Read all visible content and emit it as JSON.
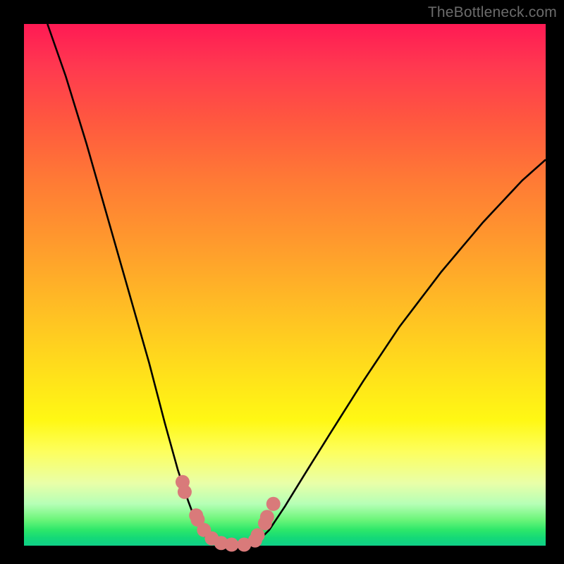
{
  "watermark": "TheBottleneck.com",
  "chart_data": {
    "type": "line",
    "title": "",
    "xlabel": "",
    "ylabel": "",
    "xlim": [
      0,
      1
    ],
    "ylim": [
      0,
      1
    ],
    "series": [
      {
        "name": "curve-left",
        "x": [
          0.045,
          0.08,
          0.12,
          0.16,
          0.2,
          0.24,
          0.27,
          0.295,
          0.315,
          0.33,
          0.345,
          0.36
        ],
        "y": [
          1.0,
          0.9,
          0.77,
          0.63,
          0.49,
          0.35,
          0.235,
          0.145,
          0.085,
          0.045,
          0.02,
          0.005
        ]
      },
      {
        "name": "curve-right",
        "x": [
          0.445,
          0.47,
          0.5,
          0.54,
          0.59,
          0.65,
          0.72,
          0.8,
          0.88,
          0.955,
          1.0
        ],
        "y": [
          0.005,
          0.03,
          0.075,
          0.14,
          0.22,
          0.315,
          0.42,
          0.525,
          0.62,
          0.7,
          0.74
        ]
      },
      {
        "name": "curve-bottom",
        "x": [
          0.36,
          0.38,
          0.4,
          0.42,
          0.445
        ],
        "y": [
          0.005,
          0.0,
          0.0,
          0.0,
          0.005
        ]
      },
      {
        "name": "dots-left",
        "x": [
          0.304,
          0.308,
          0.33,
          0.333,
          0.345,
          0.36,
          0.378,
          0.398
        ],
        "y": [
          0.122,
          0.103,
          0.058,
          0.05,
          0.03,
          0.014,
          0.005,
          0.002
        ]
      },
      {
        "name": "dots-right",
        "x": [
          0.422,
          0.443,
          0.448,
          0.462,
          0.466,
          0.478
        ],
        "y": [
          0.002,
          0.01,
          0.02,
          0.043,
          0.055,
          0.08
        ]
      }
    ],
    "colors": {
      "curve": "#000000",
      "dots": "#d97a7a",
      "gradient_top": "#ff1a54",
      "gradient_mid": "#ffd21a",
      "gradient_bottom": "#14d977"
    },
    "annotations": []
  }
}
